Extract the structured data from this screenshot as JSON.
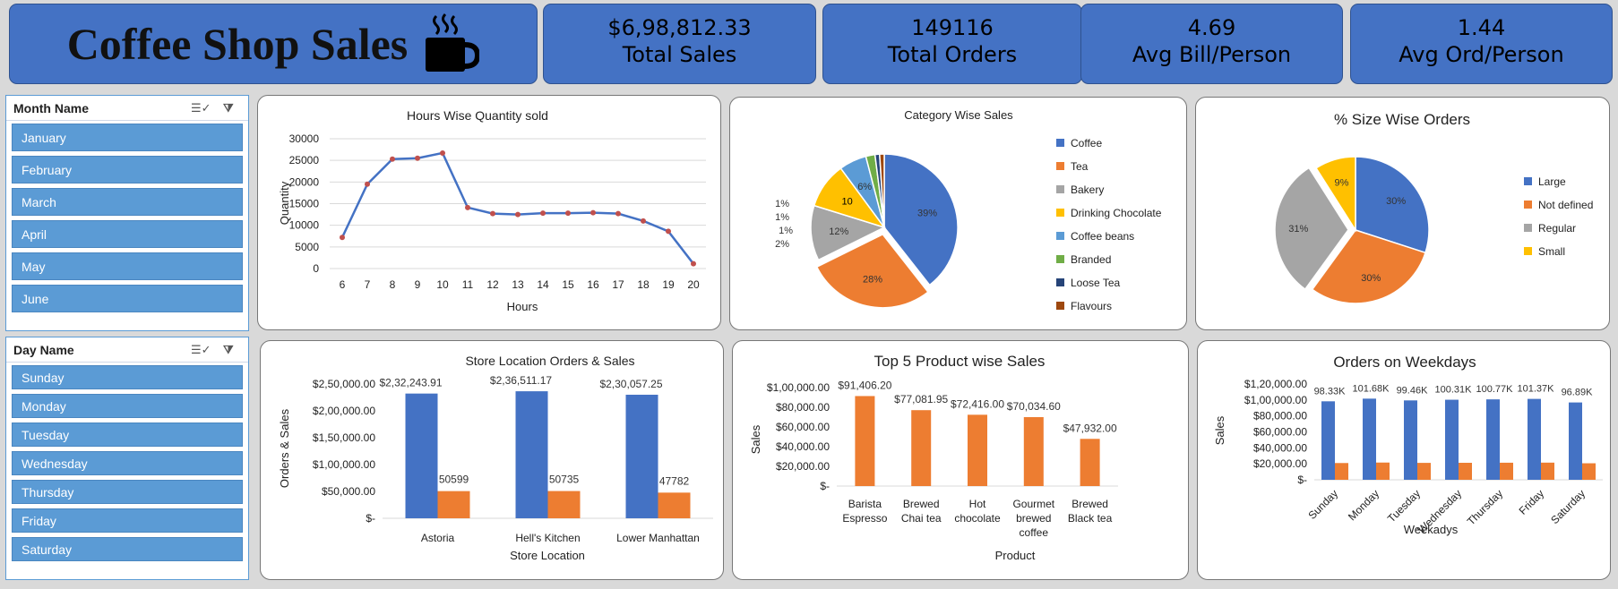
{
  "header": {
    "title": "Coffee Shop Sales",
    "kpis": [
      {
        "value": "$6,98,812.33",
        "label": "Total Sales"
      },
      {
        "value": "149116",
        "label": "Total Orders"
      },
      {
        "value": "4.69",
        "label": "Avg Bill/Person"
      },
      {
        "value": "1.44",
        "label": "Avg Ord/Person"
      }
    ]
  },
  "month_slicer": {
    "title": "Month Name",
    "items": [
      "January",
      "February",
      "March",
      "April",
      "May",
      "June"
    ]
  },
  "day_slicer": {
    "title": "Day Name",
    "items": [
      "Sunday",
      "Monday",
      "Tuesday",
      "Wednesday",
      "Thursday",
      "Friday",
      "Saturday"
    ]
  },
  "colors": {
    "blue": "#4472c4",
    "orange": "#ed7d31",
    "gray": "#a5a5a5",
    "yellow": "#ffc000",
    "lightblue": "#5b9bd5",
    "green": "#70ad47",
    "navy": "#264478",
    "brown": "#9e480e"
  },
  "chart_data": [
    {
      "id": "hours",
      "type": "line",
      "title": "Hours Wise Quantity sold",
      "xlabel": "Hours",
      "ylabel": "Quantity",
      "x": [
        "6",
        "7",
        "8",
        "9",
        "10",
        "11",
        "12",
        "13",
        "14",
        "15",
        "16",
        "17",
        "18",
        "19",
        "20"
      ],
      "values": [
        7200,
        19500,
        25300,
        25500,
        26700,
        14100,
        12700,
        12500,
        12800,
        12800,
        12900,
        12700,
        11000,
        8600,
        1100
      ],
      "ylim": [
        0,
        30000
      ],
      "yticks": [
        "0",
        "5000",
        "10000",
        "15000",
        "20000",
        "25000",
        "30000"
      ]
    },
    {
      "id": "category",
      "type": "pie",
      "title": "Category Wise Sales",
      "labels": [
        "Coffee",
        "Tea",
        "Bakery",
        "Drinking Chocolate",
        "Coffee beans",
        "Branded",
        "Loose Tea",
        "Flavours"
      ],
      "values": [
        39,
        28,
        12,
        10,
        6,
        2,
        1,
        1
      ],
      "data_labels": [
        "39%",
        "28%",
        "12%",
        "10",
        "6%",
        "2%",
        "1%",
        "1%"
      ],
      "extra_labels": [
        "1%"
      ]
    },
    {
      "id": "size",
      "type": "pie",
      "title": "% Size Wise Orders",
      "labels": [
        "Large",
        "Not defined",
        "Regular",
        "Small"
      ],
      "values": [
        30,
        30,
        31,
        9
      ],
      "data_labels": [
        "30%",
        "30%",
        "31%",
        "9%"
      ]
    },
    {
      "id": "store",
      "type": "bar",
      "title": "Store Location Orders & Sales",
      "xlabel": "Store Location",
      "ylabel": "Orders & Sales",
      "categories": [
        "Astoria",
        "Hell's Kitchen",
        "Lower Manhattan"
      ],
      "series": [
        {
          "values": [
            232243.91,
            236511.17,
            230057.25
          ],
          "labels": [
            "$2,32,243.91",
            "$2,36,511.17",
            "$2,30,057.25"
          ]
        },
        {
          "values": [
            50599,
            50735,
            47782
          ],
          "labels": [
            "50599",
            "50735",
            "47782"
          ]
        }
      ],
      "ylim": [
        0,
        250000
      ],
      "yticks": [
        "$-",
        "$50,000.00",
        "$1,00,000.00",
        "$1,50,000.00",
        "$2,00,000.00",
        "$2,50,000.00"
      ]
    },
    {
      "id": "top5",
      "type": "bar",
      "title": "Top 5 Product wise Sales",
      "xlabel": "Product",
      "ylabel": "Sales",
      "categories": [
        [
          "Barista",
          "Espresso"
        ],
        [
          "Brewed",
          "Chai tea"
        ],
        [
          "Hot",
          "chocolate"
        ],
        [
          "Gourmet",
          "brewed",
          "coffee"
        ],
        [
          "Brewed",
          "Black tea"
        ]
      ],
      "values": [
        91406.2,
        77081.95,
        72416.0,
        70034.6,
        47932.0
      ],
      "data_labels": [
        "$91,406.20",
        "$77,081.95",
        "$72,416.00",
        "$70,034.60",
        "$47,932.00"
      ],
      "ylim": [
        0,
        100000
      ],
      "yticks": [
        "$-",
        "$20,000.00",
        "$40,000.00",
        "$60,000.00",
        "$80,000.00",
        "$1,00,000.00"
      ]
    },
    {
      "id": "weekdays",
      "type": "bar",
      "title": "Orders on Weekdays",
      "xlabel": "Weekadys",
      "ylabel": "Sales",
      "categories": [
        "Sunday",
        "Monday",
        "Tuesday",
        "Wednesday",
        "Thursday",
        "Friday",
        "Saturday"
      ],
      "series": [
        {
          "values": [
            98330,
            101680,
            99460,
            100310,
            100770,
            101370,
            96890
          ],
          "labels": [
            "98.33K",
            "101.68K",
            "99.46K",
            "100.31K",
            "100.77K",
            "101.37K",
            "96.89K"
          ]
        },
        {
          "values": [
            21000,
            21600,
            21200,
            21300,
            21400,
            21500,
            20700
          ]
        }
      ],
      "ylim": [
        0,
        120000
      ],
      "yticks": [
        "$-",
        "$20,000.00",
        "$40,000.00",
        "$60,000.00",
        "$80,000.00",
        "$1,00,000.00",
        "$1,20,000.00"
      ]
    }
  ]
}
